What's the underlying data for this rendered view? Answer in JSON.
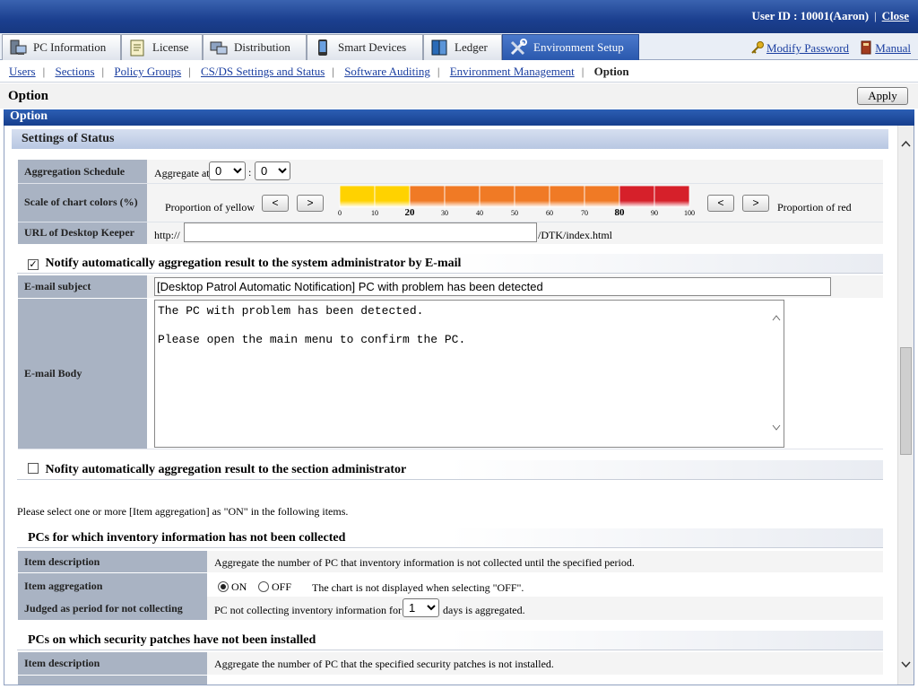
{
  "header": {
    "user_label": "User ID : 10001(Aaron)",
    "close": "Close"
  },
  "tabs": [
    {
      "label": "PC Information",
      "icon": "pc-icon"
    },
    {
      "label": "License",
      "icon": "license-icon"
    },
    {
      "label": "Distribution",
      "icon": "distribution-icon"
    },
    {
      "label": "Smart Devices",
      "icon": "smart-device-icon"
    },
    {
      "label": "Ledger",
      "icon": "ledger-icon"
    },
    {
      "label": "Environment Setup",
      "icon": "tools-icon",
      "active": true
    }
  ],
  "right_links": {
    "modify_password": "Modify Password",
    "manual": "Manual"
  },
  "subnav": {
    "items": [
      "Users",
      "Sections",
      "Policy Groups",
      "CS/DS Settings and Status",
      "Software Auditing",
      "Environment Management"
    ],
    "current": "Option"
  },
  "page": {
    "title": "Option",
    "apply": "Apply",
    "section": "Option"
  },
  "status": {
    "group_title": "Settings of Status",
    "aggregation_schedule": {
      "label": "Aggregation Schedule",
      "prefix": "Aggregate at",
      "hour": "0",
      "minute": "0",
      "separator": ":"
    },
    "chart_colors": {
      "label": "Scale of chart colors (%)",
      "yellow_label": "Proportion of yellow",
      "red_label": "Proportion of red",
      "btn_left": "<",
      "btn_right": ">",
      "scale_ticks": [
        "0",
        "10",
        "20",
        "30",
        "40",
        "50",
        "60",
        "70",
        "80",
        "90",
        "100"
      ],
      "yellow_threshold": 20,
      "red_threshold": 80,
      "colors": {
        "yellow": "#ffd200",
        "orange": "#f07a25",
        "red": "#d6202a"
      }
    },
    "url": {
      "label": "URL of Desktop Keeper",
      "prefix": "http://",
      "value": "",
      "suffix": "/DTK/index.html"
    }
  },
  "email_admin": {
    "checked": true,
    "title": "Notify automatically aggregation result to the system administrator by E-mail",
    "subject_label": "E-mail subject",
    "subject_value": "[Desktop Patrol Automatic Notification] PC with problem has been detected",
    "body_label": "E-mail Body",
    "body_line1": "The PC with problem has been detected.",
    "body_line2": "Please open the main menu to confirm the PC."
  },
  "section_admin": {
    "checked": false,
    "title": "Nofity automatically aggregation result to the section administrator"
  },
  "note": "Please select one or more [Item aggregation] as \"ON\" in the following items.",
  "inventory": {
    "title": "PCs for which inventory information has not been collected",
    "desc_label": "Item description",
    "desc_value": "Aggregate the number of PC that inventory information is not collected until the specified period.",
    "agg_label": "Item aggregation",
    "on": "ON",
    "off": "OFF",
    "agg_note": "The chart is not displayed when selecting \"OFF\".",
    "selected": "ON",
    "period_label": "Judged as period for not collecting",
    "period_prefix": "PC not collecting inventory information for",
    "period_value": "1",
    "period_suffix": "days is aggregated."
  },
  "patches": {
    "title": "PCs on which security patches have not been installed",
    "desc_label": "Item description",
    "desc_value": "Aggregate the number of PC that the specified security patches is not installed."
  }
}
